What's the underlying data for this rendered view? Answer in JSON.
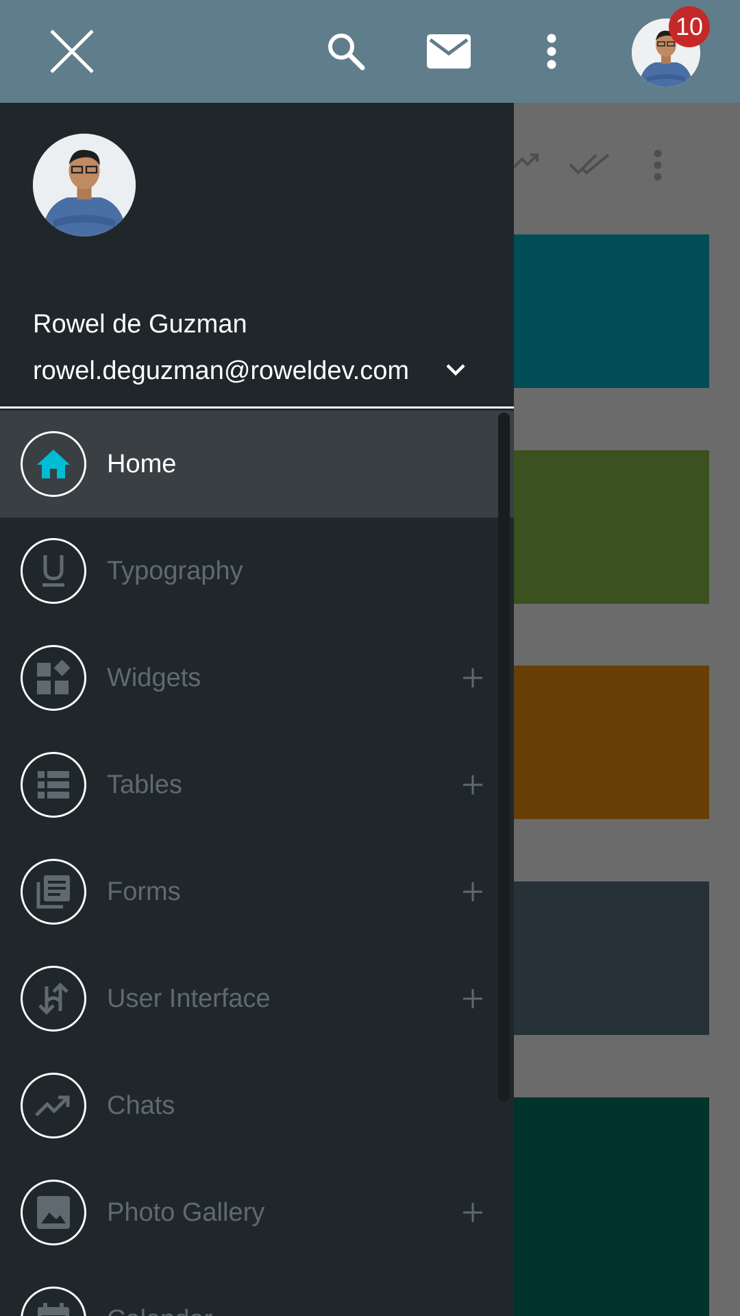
{
  "app_bar": {
    "notification_count": "10",
    "icons": [
      "close-icon",
      "search-icon",
      "mail-icon",
      "more-vert-icon",
      "avatar"
    ],
    "background": "#607d8b"
  },
  "drawer": {
    "user_name": "Rowel de Guzman",
    "user_email": "rowel.deguzman@roweldev.com",
    "background": "#20272b",
    "accent": "#00bcd4",
    "items": [
      {
        "label": "Home",
        "icon": "home-icon",
        "active": true,
        "expandable": false
      },
      {
        "label": "Typography",
        "icon": "underline-icon",
        "active": false,
        "expandable": false
      },
      {
        "label": "Widgets",
        "icon": "widgets-icon",
        "active": false,
        "expandable": true
      },
      {
        "label": "Tables",
        "icon": "list-icon",
        "active": false,
        "expandable": true
      },
      {
        "label": "Forms",
        "icon": "library-books-icon",
        "active": false,
        "expandable": true
      },
      {
        "label": "User Interface",
        "icon": "swap-vert-icon",
        "active": false,
        "expandable": true
      },
      {
        "label": "Chats",
        "icon": "trending-up-icon",
        "active": false,
        "expandable": false
      },
      {
        "label": "Photo Gallery",
        "icon": "image-icon",
        "active": false,
        "expandable": true
      },
      {
        "label": "Calendar",
        "icon": "calendar-icon",
        "active": false,
        "expandable": false
      }
    ]
  },
  "background_cards": [
    "#004d58",
    "#3b5120",
    "#673f06",
    "#263238",
    "#01332e"
  ]
}
